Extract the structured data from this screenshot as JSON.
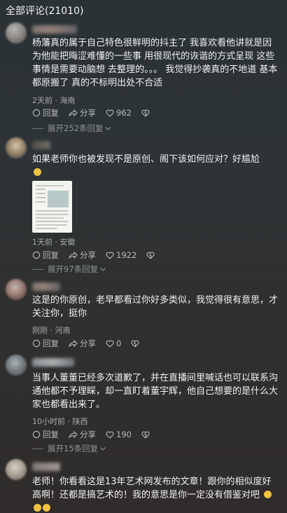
{
  "header": {
    "title": "全部评论(21010)"
  },
  "comments": [
    {
      "text": "杨藩真的属于自己特色很鲜明的抖主了 我喜欢看他讲就是因为他能把晦涩难懂的一些事 用很现代的诙谐的方式呈现 这些事情是需要动脑想 去整理的。。。 我觉得抄袭真的不地道 基本都原搬了 真的不标明出处不合适",
      "meta": "2天前 · 海南",
      "reply": "回复",
      "share": "分享",
      "likes": "962",
      "expand": "展开252条回复"
    },
    {
      "text": "如果老师你也被发现不是原创、阁下该如何应对？好尴尬",
      "meta": "1天前 · 安徽",
      "reply": "回复",
      "share": "分享",
      "likes": "1922",
      "expand": "展开97条回复"
    },
    {
      "text": "这是的你原创，老早都看过你好多类似，我觉得很有意思，才关注你，挺你",
      "meta": "刚刚 · 河南",
      "reply": "回复",
      "share": "分享",
      "likes": "0"
    },
    {
      "text": "当事人董董已经多次道歉了，并在直播间里喊话也可以联系沟通他都不予理睬，却一直盯着董宇辉，他自己想要的是什么大家也都看出来了。",
      "meta": "10小时前 · 陕西",
      "reply": "回复",
      "share": "分享",
      "likes": "190",
      "expand": "展开15条回复"
    },
    {
      "text": "老师！你看看这是13年艺术网发布的文章！跟你的相似度好高啊！还都是搞艺术的！我的意思是你一定没有借鉴对吧"
    }
  ],
  "colors": {
    "background": "#2d3337",
    "text": "#f0f0f0",
    "meta": "#a7a9aa",
    "muted": "#8d9193"
  }
}
